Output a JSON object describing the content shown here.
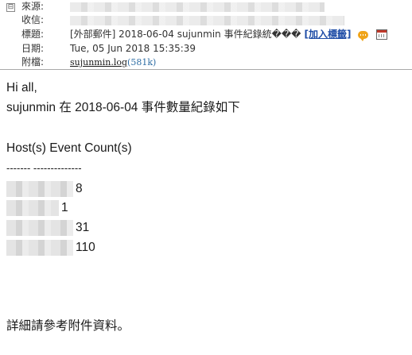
{
  "header": {
    "from_label": "來源:",
    "to_label": "收信:",
    "subject_label": "標題:",
    "subject_value": "[外部郵件] 2018-06-04 sujunmin 事件紀錄統���",
    "add_label_link": "[加入標籤]",
    "date_label": "日期:",
    "date_value": "Tue, 05 Jun 2018 15:35:39",
    "attachment_label": "附檔:",
    "attachment_name": "sujunmin.log",
    "attachment_size": "(581k)",
    "toggle_symbol": "⊟"
  },
  "body": {
    "greeting": "Hi all,",
    "intro": "sujunmin 在 2018-06-04 事件數量紀錄如下",
    "table_header": "Host(s) Event Count(s)",
    "separator": "------- --------------",
    "rows": [
      {
        "count": "8"
      },
      {
        "count": "1"
      },
      {
        "count": "31"
      },
      {
        "count": "110"
      }
    ],
    "footer": "詳細請參考附件資料。"
  }
}
